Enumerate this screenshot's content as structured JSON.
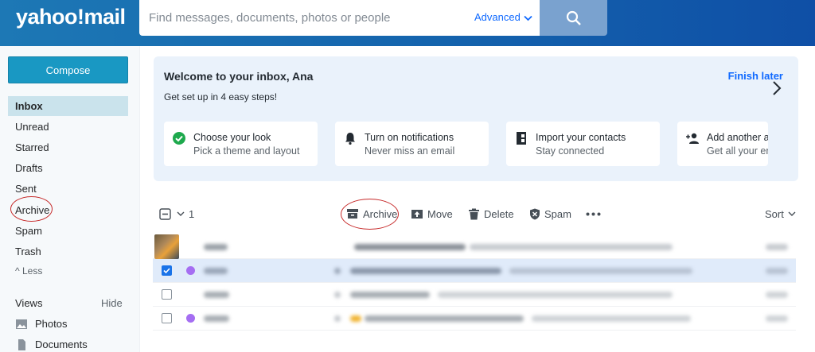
{
  "header": {
    "logo": "yahoo!mail",
    "search_placeholder": "Find messages, documents, photos or people",
    "advanced_label": "Advanced"
  },
  "sidebar": {
    "compose_label": "Compose",
    "folders": [
      "Inbox",
      "Unread",
      "Starred",
      "Drafts",
      "Sent",
      "Archive",
      "Spam",
      "Trash"
    ],
    "less_label": "^ Less",
    "views_label": "Views",
    "hide_label": "Hide",
    "views": [
      "Photos",
      "Documents"
    ]
  },
  "welcome": {
    "title": "Welcome to your inbox, Ana",
    "subtitle": "Get set up in 4 easy steps!",
    "finish_label": "Finish later",
    "cards": [
      {
        "title": "Choose your look",
        "subtitle": "Pick a theme and layout",
        "icon": "check-circle-icon"
      },
      {
        "title": "Turn on notifications",
        "subtitle": "Never miss an email",
        "icon": "bell-icon"
      },
      {
        "title": "Import your contacts",
        "subtitle": "Stay connected",
        "icon": "contacts-book-icon"
      },
      {
        "title": "Add another a",
        "subtitle": "Get all your er",
        "icon": "add-person-icon"
      }
    ]
  },
  "toolbar": {
    "selected_count": "1",
    "archive_label": "Archive",
    "move_label": "Move",
    "delete_label": "Delete",
    "spam_label": "Spam",
    "sort_label": "Sort"
  },
  "colors": {
    "header_blue": "#1463ad",
    "compose": "#1998c3",
    "link_blue": "#0f69ff",
    "annotation_red": "#c62828",
    "selected_row": "#e0ebfa"
  }
}
